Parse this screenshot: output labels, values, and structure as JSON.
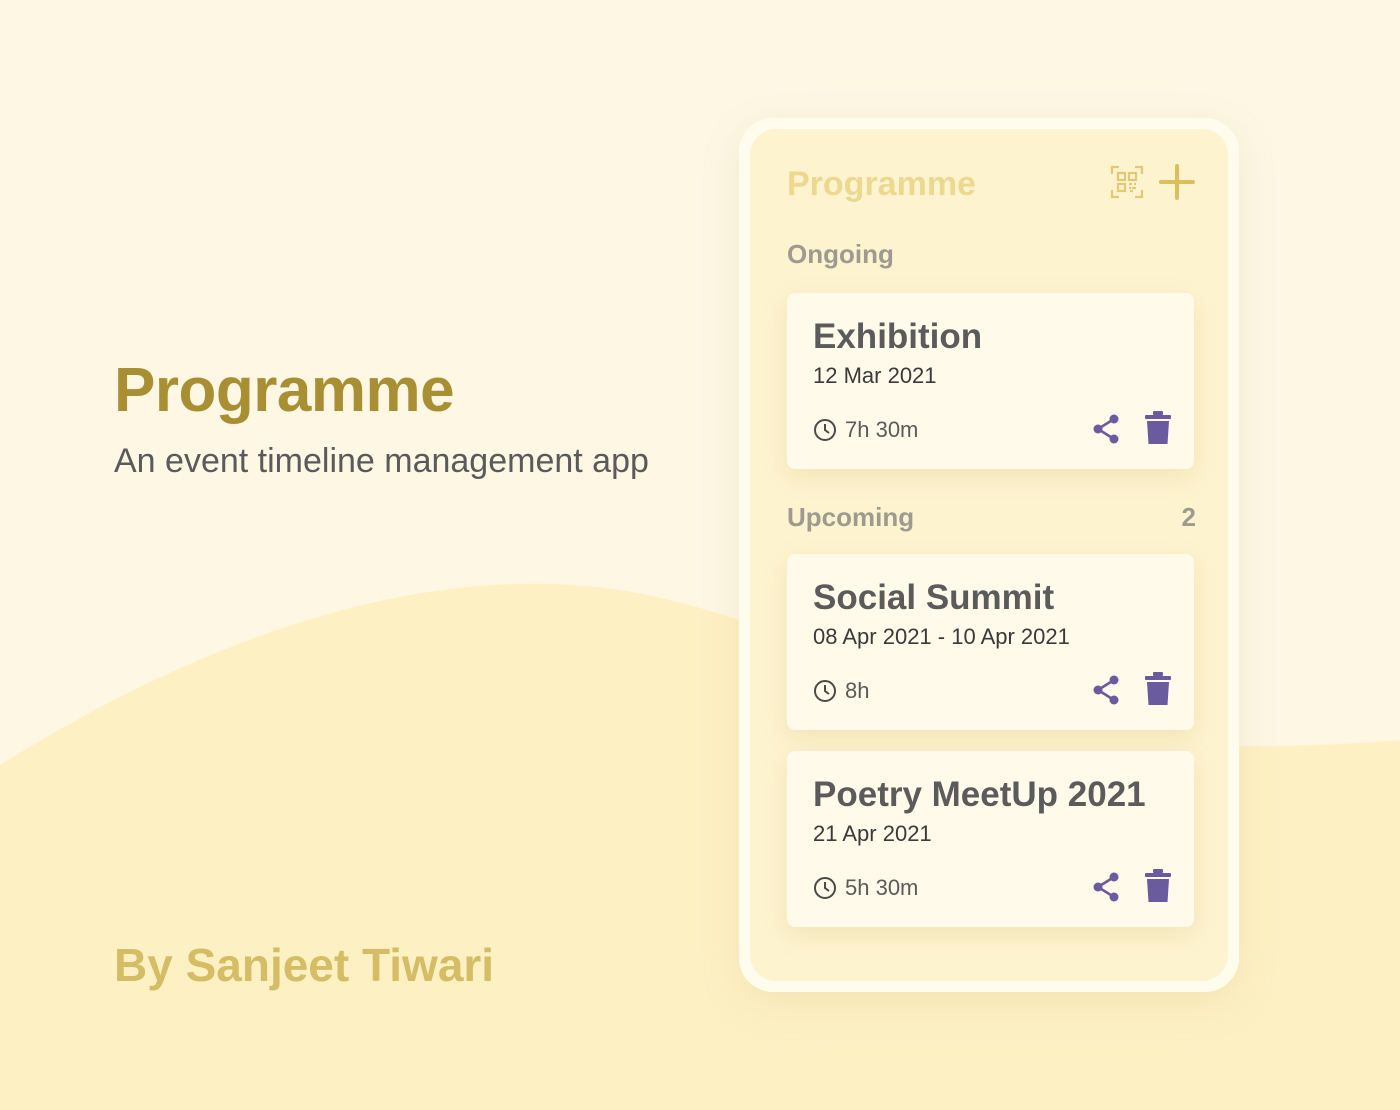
{
  "promo": {
    "title": "Programme",
    "subtitle": "An event timeline management app",
    "author": "By Sanjeet Tiwari"
  },
  "app": {
    "title": "Programme",
    "ongoing_label": "Ongoing",
    "upcoming_label": "Upcoming",
    "upcoming_count": "2",
    "icons": {
      "scan": "qr-scan-icon",
      "add": "plus-icon",
      "clock": "clock-icon",
      "share": "share-icon",
      "delete": "trash-icon"
    }
  },
  "events": [
    {
      "title": "Exhibition",
      "date": "12 Mar 2021",
      "duration": "7h 30m"
    },
    {
      "title": "Social Summit",
      "date": "08 Apr 2021 - 10 Apr 2021",
      "duration": "8h"
    },
    {
      "title": "Poetry MeetUp 2021",
      "date": "21 Apr 2021",
      "duration": "5h 30m"
    }
  ],
  "colors": {
    "background": "#fdf7e4",
    "brand_gold": "#a98f34",
    "author_gold": "#d5bd66",
    "app_title": "#ecd98f",
    "action_purple": "#6a5a9e"
  }
}
